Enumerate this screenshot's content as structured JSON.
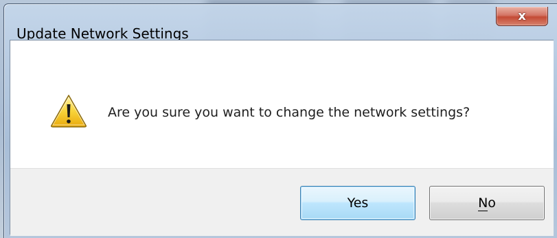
{
  "dialog": {
    "title": "Update Network Settings",
    "close_glyph": "x",
    "message": "Are you sure you want to change the network settings?",
    "icon": "warning-icon",
    "buttons": {
      "yes": {
        "label": "Yes",
        "default": true
      },
      "no": {
        "mnemonic": "N",
        "rest": "o"
      }
    }
  },
  "colors": {
    "close_button": "#c44a35",
    "default_button_border": "#3c7fb1",
    "warning_yellow": "#f5c518"
  }
}
